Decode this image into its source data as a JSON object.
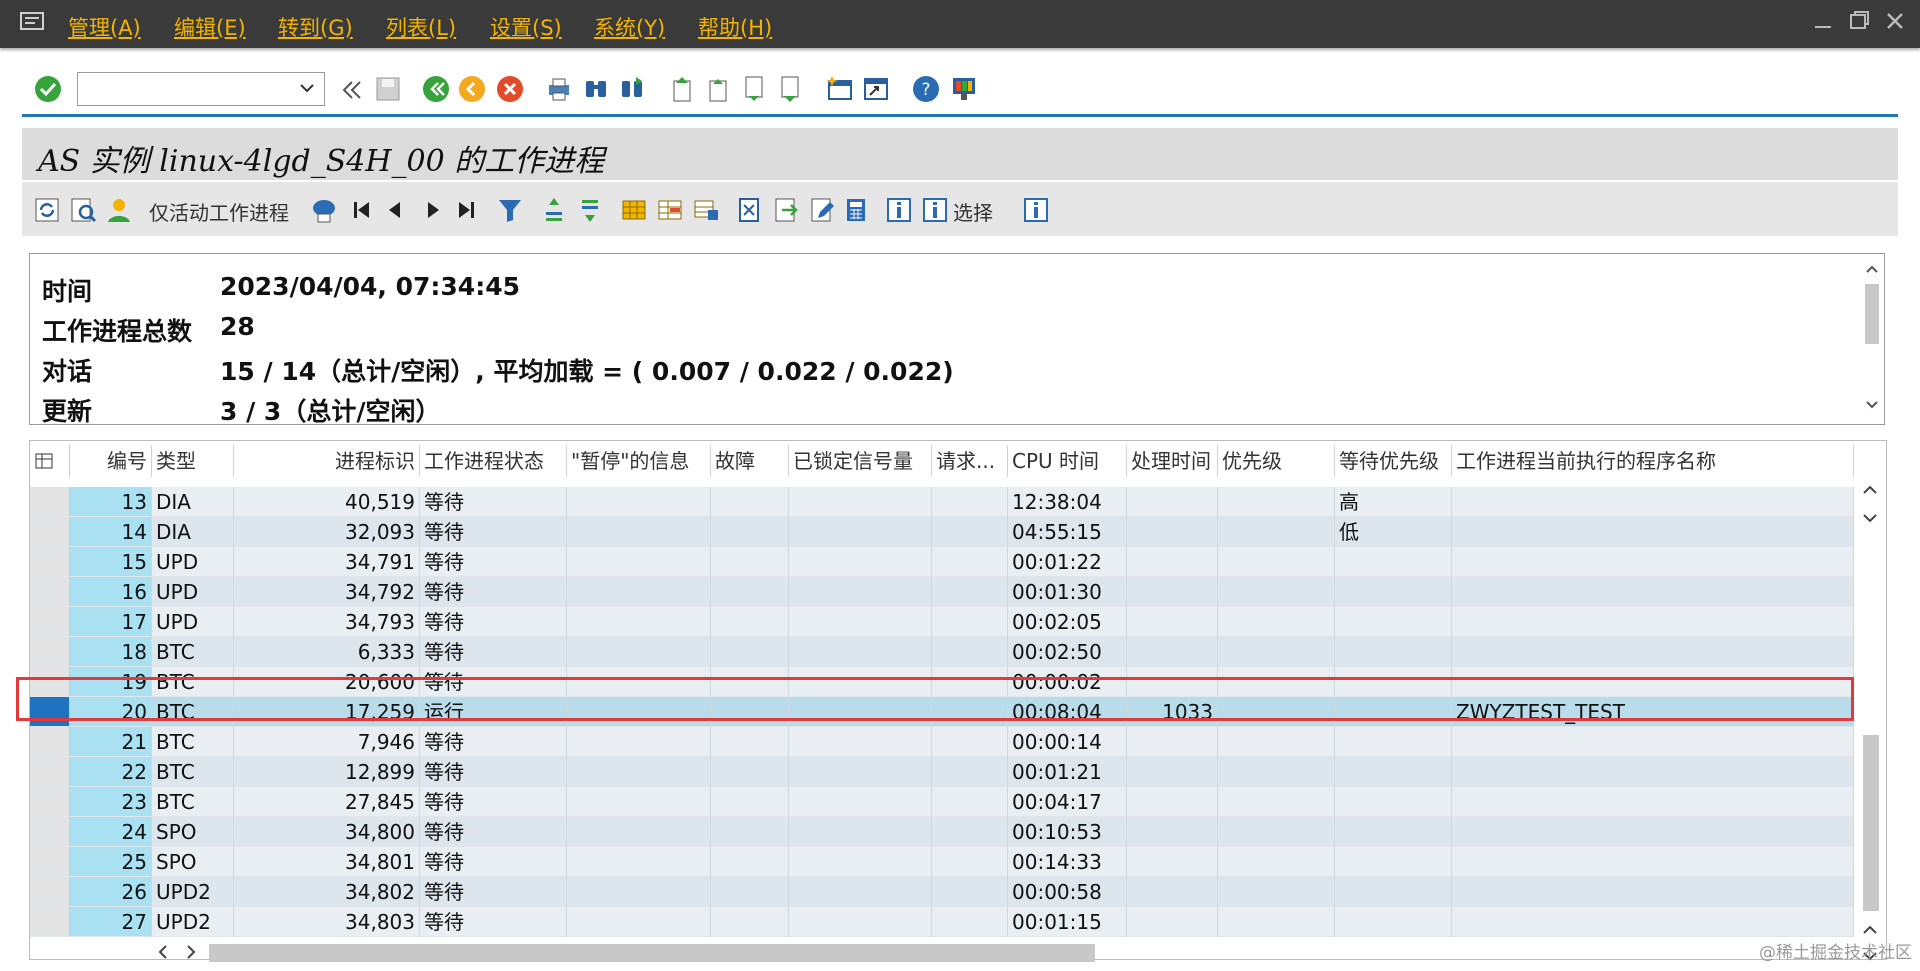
{
  "menubar": {
    "items": [
      "管理(A)",
      "编辑(E)",
      "转到(G)",
      "列表(L)",
      "设置(S)",
      "系统(Y)",
      "帮助(H)"
    ]
  },
  "toolbar": {
    "command_value": ""
  },
  "title": "AS 实例 linux-4lgd_S4H_00 的工作进程",
  "app_toolbar": {
    "active_only_label": "仅活动工作进程",
    "select_label": "选择"
  },
  "info": {
    "rows": [
      {
        "label": "时间",
        "value": "2023/04/04, 07:34:45"
      },
      {
        "label": "工作进程总数",
        "value": "28"
      },
      {
        "label": "对话",
        "value": "15 / 14（总计/空闲）, 平均加载 = ( 0.007 / 0.022 / 0.022)"
      },
      {
        "label": "更新",
        "value": "3 / 3（总计/空闲）"
      }
    ]
  },
  "grid": {
    "headers": [
      "编号",
      "类型",
      "进程标识",
      "工作进程状态",
      "\"暂停\"的信息",
      "故障",
      "已锁定信号量",
      "请求...",
      "CPU 时间",
      "处理时间",
      "优先级",
      "等待优先级",
      "工作进程当前执行的程序名称"
    ],
    "rows": [
      [
        "13",
        "DIA",
        "40,519",
        "等待",
        "",
        "",
        "",
        "",
        "12:38:04",
        "",
        "",
        "高",
        ""
      ],
      [
        "14",
        "DIA",
        "32,093",
        "等待",
        "",
        "",
        "",
        "",
        "04:55:15",
        "",
        "",
        "低",
        ""
      ],
      [
        "15",
        "UPD",
        "34,791",
        "等待",
        "",
        "",
        "",
        "",
        "00:01:22",
        "",
        "",
        "",
        ""
      ],
      [
        "16",
        "UPD",
        "34,792",
        "等待",
        "",
        "",
        "",
        "",
        "00:01:30",
        "",
        "",
        "",
        ""
      ],
      [
        "17",
        "UPD",
        "34,793",
        "等待",
        "",
        "",
        "",
        "",
        "00:02:05",
        "",
        "",
        "",
        ""
      ],
      [
        "18",
        "BTC",
        "6,333",
        "等待",
        "",
        "",
        "",
        "",
        "00:02:50",
        "",
        "",
        "",
        ""
      ],
      [
        "19",
        "BTC",
        "20,600",
        "等待",
        "",
        "",
        "",
        "",
        "00:00:02",
        "",
        "",
        "",
        ""
      ],
      [
        "20",
        "BTC",
        "17,259",
        "运行",
        "",
        "",
        "",
        "",
        "00:08:04",
        "1033",
        "",
        "",
        "ZWYZTEST_TEST"
      ],
      [
        "21",
        "BTC",
        "7,946",
        "等待",
        "",
        "",
        "",
        "",
        "00:00:14",
        "",
        "",
        "",
        ""
      ],
      [
        "22",
        "BTC",
        "12,899",
        "等待",
        "",
        "",
        "",
        "",
        "00:01:21",
        "",
        "",
        "",
        ""
      ],
      [
        "23",
        "BTC",
        "27,845",
        "等待",
        "",
        "",
        "",
        "",
        "00:04:17",
        "",
        "",
        "",
        ""
      ],
      [
        "24",
        "SPO",
        "34,800",
        "等待",
        "",
        "",
        "",
        "",
        "00:10:53",
        "",
        "",
        "",
        ""
      ],
      [
        "25",
        "SPO",
        "34,801",
        "等待",
        "",
        "",
        "",
        "",
        "00:14:33",
        "",
        "",
        "",
        ""
      ],
      [
        "26",
        "UPD2",
        "34,802",
        "等待",
        "",
        "",
        "",
        "",
        "00:00:58",
        "",
        "",
        "",
        ""
      ],
      [
        "27",
        "UPD2",
        "34,803",
        "等待",
        "",
        "",
        "",
        "",
        "00:01:15",
        "",
        "",
        "",
        ""
      ]
    ],
    "selected_row": 7
  },
  "watermark": "@稀土掘金技术社区",
  "colors": {
    "menubar": "#3a3a3a",
    "menu_text": "#f3b300",
    "accent_line": "#1f78b4",
    "key_column": "#a9e0f2",
    "highlight_box": "#e23a3a"
  },
  "icons": [
    "check-icon",
    "back-icon",
    "save-icon",
    "back-green-icon",
    "exit-icon",
    "cancel-icon",
    "print-icon",
    "find-icon",
    "find-next-icon",
    "first-page-icon",
    "prev-page-icon",
    "next-page-icon",
    "last-page-icon",
    "new-session-icon",
    "shortcut-icon",
    "help-icon",
    "layout-icon"
  ]
}
